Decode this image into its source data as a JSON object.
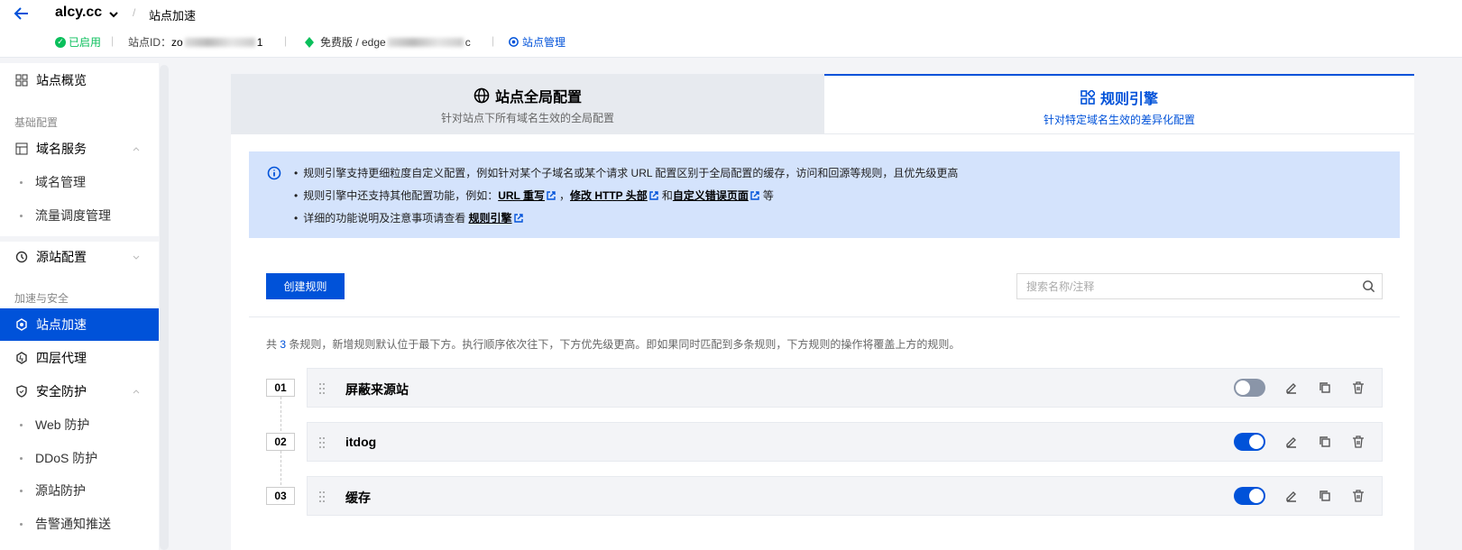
{
  "header": {
    "site_name": "alcy.cc",
    "breadcrumb_sep": "/",
    "breadcrumb": "站点加速",
    "status": "已启用",
    "site_id_label": "站点ID：",
    "site_id_prefix": "zo",
    "site_id_suffix": "1",
    "plan_prefix": "免费版 / edge",
    "plan_suffix": "c",
    "site_manage": "站点管理",
    "sep": "|"
  },
  "sidebar": {
    "overview": "站点概览",
    "section_basic": "基础配置",
    "domain_service": "域名服务",
    "domain_manage": "域名管理",
    "traffic_schedule": "流量调度管理",
    "origin_config": "源站配置",
    "section_accel": "加速与安全",
    "site_accel": "站点加速",
    "l4_proxy": "四层代理",
    "security": "安全防护",
    "web_protect": "Web 防护",
    "ddos_protect": "DDoS 防护",
    "origin_protect": "源站防护",
    "alert_push": "告警通知推送"
  },
  "tabs": {
    "global_title": "站点全局配置",
    "global_sub": "针对站点下所有域名生效的全局配置",
    "rules_title": "规则引擎",
    "rules_sub": "针对特定域名生效的差异化配置"
  },
  "notice": {
    "line1": "规则引擎支持更细粒度自定义配置，例如针对某个子域名或某个请求 URL 配置区别于全局配置的缓存，访问和回源等规则，且优先级更高",
    "line2_prefix": "规则引擎中还支持其他配置功能，例如：",
    "link_url_rewrite": "URL 重写",
    "comma": "，",
    "link_http_header": "修改 HTTP 头部",
    "and": "和",
    "link_error_page": "自定义错误页面",
    "etc": "等",
    "line3_prefix": "详细的功能说明及注意事项请查看 ",
    "link_rules_engine": "规则引擎"
  },
  "toolbar": {
    "create_label": "创建规则",
    "search_placeholder": "搜索名称/注释"
  },
  "summary": {
    "prefix": "共 ",
    "count": "3",
    "suffix": " 条规则，新增规则默认位于最下方。执行顺序依次往下，下方优先级更高。即如果同时匹配到多条规则，下方规则的操作将覆盖上方的规则。"
  },
  "rules": [
    {
      "index": "01",
      "name": "屏蔽来源站",
      "enabled": false
    },
    {
      "index": "02",
      "name": "itdog",
      "enabled": true
    },
    {
      "index": "03",
      "name": "缓存",
      "enabled": true
    }
  ],
  "colors": {
    "primary": "#0052d9",
    "success": "#0abf5b",
    "notice_bg": "#d4e3fc"
  }
}
